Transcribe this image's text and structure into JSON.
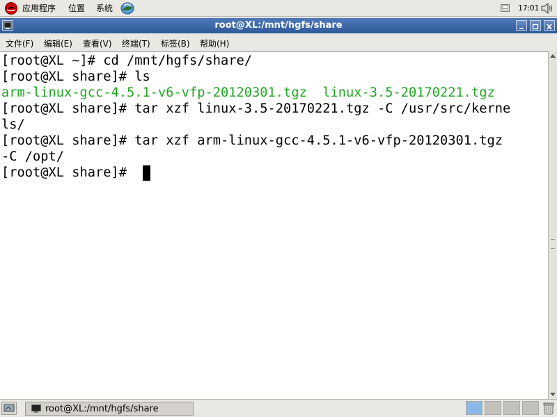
{
  "top_panel": {
    "menus": [
      "应用程序",
      "位置",
      "系统"
    ],
    "clock": "17:01"
  },
  "window": {
    "title": "root@XL:/mnt/hgfs/share",
    "menu": [
      "文件(F)",
      "编辑(E)",
      "查看(V)",
      "终端(T)",
      "标签(B)",
      "帮助(H)"
    ]
  },
  "terminal": {
    "lines": [
      "[root@XL ~]# cd /mnt/hgfs/share/",
      "[root@XL share]# ls",
      "arm-linux-gcc-4.5.1-v6-vfp-20120301.tgz  linux-3.5-20170221.tgz",
      "[root@XL share]# tar xzf linux-3.5-20170221.tgz -C /usr/src/kerne",
      "ls/",
      "[root@XL share]# tar xzf arm-linux-gcc-4.5.1-v6-vfp-20120301.tgz",
      "-C /opt/",
      "[root@XL share]# "
    ],
    "ls_color": "#22a522"
  },
  "taskbar": {
    "task_label": "root@XL:/mnt/hgfs/share",
    "workspace_active_color": "#8cb8e8"
  },
  "icons": [
    "redhat-logo-icon",
    "browser-icon",
    "notification-icon",
    "volume-icon",
    "window-menu-icon",
    "minimize-icon",
    "maximize-icon",
    "close-icon",
    "show-desktop-icon",
    "terminal-icon",
    "trash-icon"
  ]
}
